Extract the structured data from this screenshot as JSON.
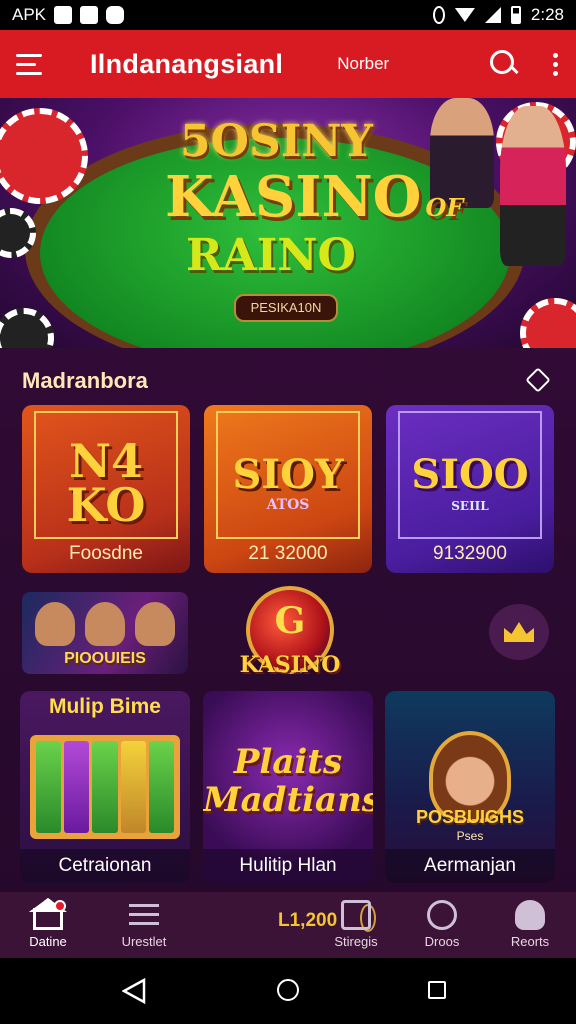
{
  "status_bar": {
    "carrier": "APK",
    "time": "2:28"
  },
  "app_bar": {
    "title": "Ilndanangsianl",
    "subtitle": "Norber"
  },
  "banner": {
    "line1": "5OSINY",
    "line2": "KASINO",
    "suffix": "OF",
    "line3": "RAINO",
    "cta": "PESIKA10N"
  },
  "section": {
    "title": "Madranbora"
  },
  "games_row1": [
    {
      "logo": "N4 KO",
      "caption": "Foosdne"
    },
    {
      "logo": "SIOY",
      "sub": "ATOS",
      "caption": "21 32000"
    },
    {
      "logo": "SIOO",
      "sub": "SEIIL",
      "caption": "9132900"
    }
  ],
  "games_row2": {
    "left_label": "PIOOUIEIS",
    "center_logo_letter": "G",
    "center_logo_label": "KASINO"
  },
  "games_row3": [
    {
      "title": "Mulip Bime",
      "caption": "Cetraionan"
    },
    {
      "title": "Plaits Madtians",
      "caption": "Hulitip Hlan"
    },
    {
      "title": "POSBUIGHS",
      "sub": "Pses",
      "caption": "Aermanjan"
    }
  ],
  "bottom_nav": {
    "items": [
      {
        "label": "Datine",
        "icon": "home-icon"
      },
      {
        "label": "Urestlet",
        "icon": "list-icon"
      },
      {
        "label": "Stiregis",
        "icon": "wallet-icon"
      },
      {
        "label": "Droos",
        "icon": "blocked-icon"
      },
      {
        "label": "Reorts",
        "icon": "ghost-icon"
      }
    ],
    "balance": "L1,200"
  },
  "colors": {
    "app_bar": "#d81b22",
    "accent_gold": "#f4c431",
    "background": "#2b0a30"
  }
}
